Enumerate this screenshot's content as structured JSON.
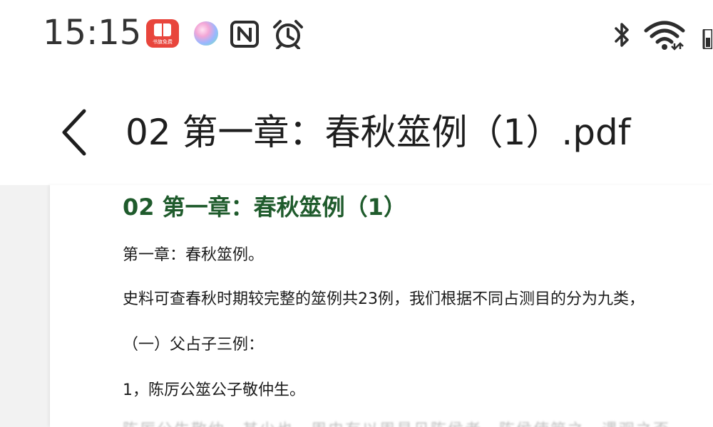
{
  "status_bar": {
    "time": "15:15",
    "notification_icons": [
      "red-reader-app-icon",
      "color-orb-app-icon",
      "nfc-icon",
      "alarm-icon"
    ],
    "red_app_caption": "书旗免费",
    "system_icons": [
      "bluetooth-icon",
      "wifi-icon",
      "battery-icon"
    ]
  },
  "app_bar": {
    "back_icon": "chevron-left-icon",
    "title": "02 第一章：春秋筮例（1）.pdf"
  },
  "document": {
    "heading": "02 第一章：春秋筮例（1）",
    "paragraphs": [
      "第一章：春秋筮例。",
      "史料可查春秋时期较完整的筮例共23例，我们根据不同占测目的分为九类，",
      "（一）父占子三例：",
      "1，陈厉公筮公子敬仲生。",
      "陈厉公生敬仲，其少也，周史有以周易见陈侯者，陈侯使筮之，遇观之否"
    ]
  },
  "colors": {
    "heading_green": "#1f5b2c",
    "red_app": "#e8453c",
    "text": "#1b1b1b",
    "background": "#ffffff"
  }
}
